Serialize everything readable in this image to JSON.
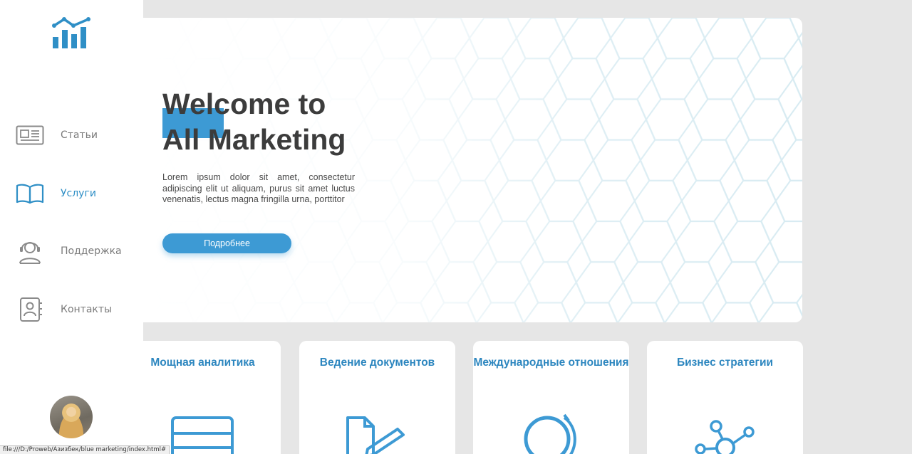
{
  "sidebar": {
    "logo": "bar-chart-trend-logo",
    "items": [
      {
        "label": "Статьи",
        "icon": "newspaper-icon",
        "active": false
      },
      {
        "label": "Услуги",
        "icon": "book-icon",
        "active": true
      },
      {
        "label": "Поддержка",
        "icon": "support-headset-icon",
        "active": false
      },
      {
        "label": "Контакты",
        "icon": "contacts-book-icon",
        "active": false
      }
    ],
    "avatar": "user-avatar"
  },
  "hero": {
    "title_line1": "Welcome to",
    "title_line2": "All Marketing",
    "text": "Lorem ipsum dolor sit amet, consectetur adipiscing elit ut aliquam, purus sit amet luctus venenatis, lectus magna fringilla urna, porttitor",
    "button_label": "Подробнее"
  },
  "cards": [
    {
      "title": "Мощная аналитика",
      "icon": "analytics-icon"
    },
    {
      "title": "Ведение документов",
      "icon": "document-edit-icon"
    },
    {
      "title": "Международные отношения",
      "icon": "globe-icon"
    },
    {
      "title": "Бизнес стратегии",
      "icon": "network-nodes-icon"
    }
  ],
  "status_bar": {
    "url": "file:///D:/Proweb/Азизбек/blue marketing/index.html#"
  },
  "colors": {
    "accent": "#3d9ad4",
    "card_title": "#2c86bf",
    "background": "#e6e6e6"
  }
}
